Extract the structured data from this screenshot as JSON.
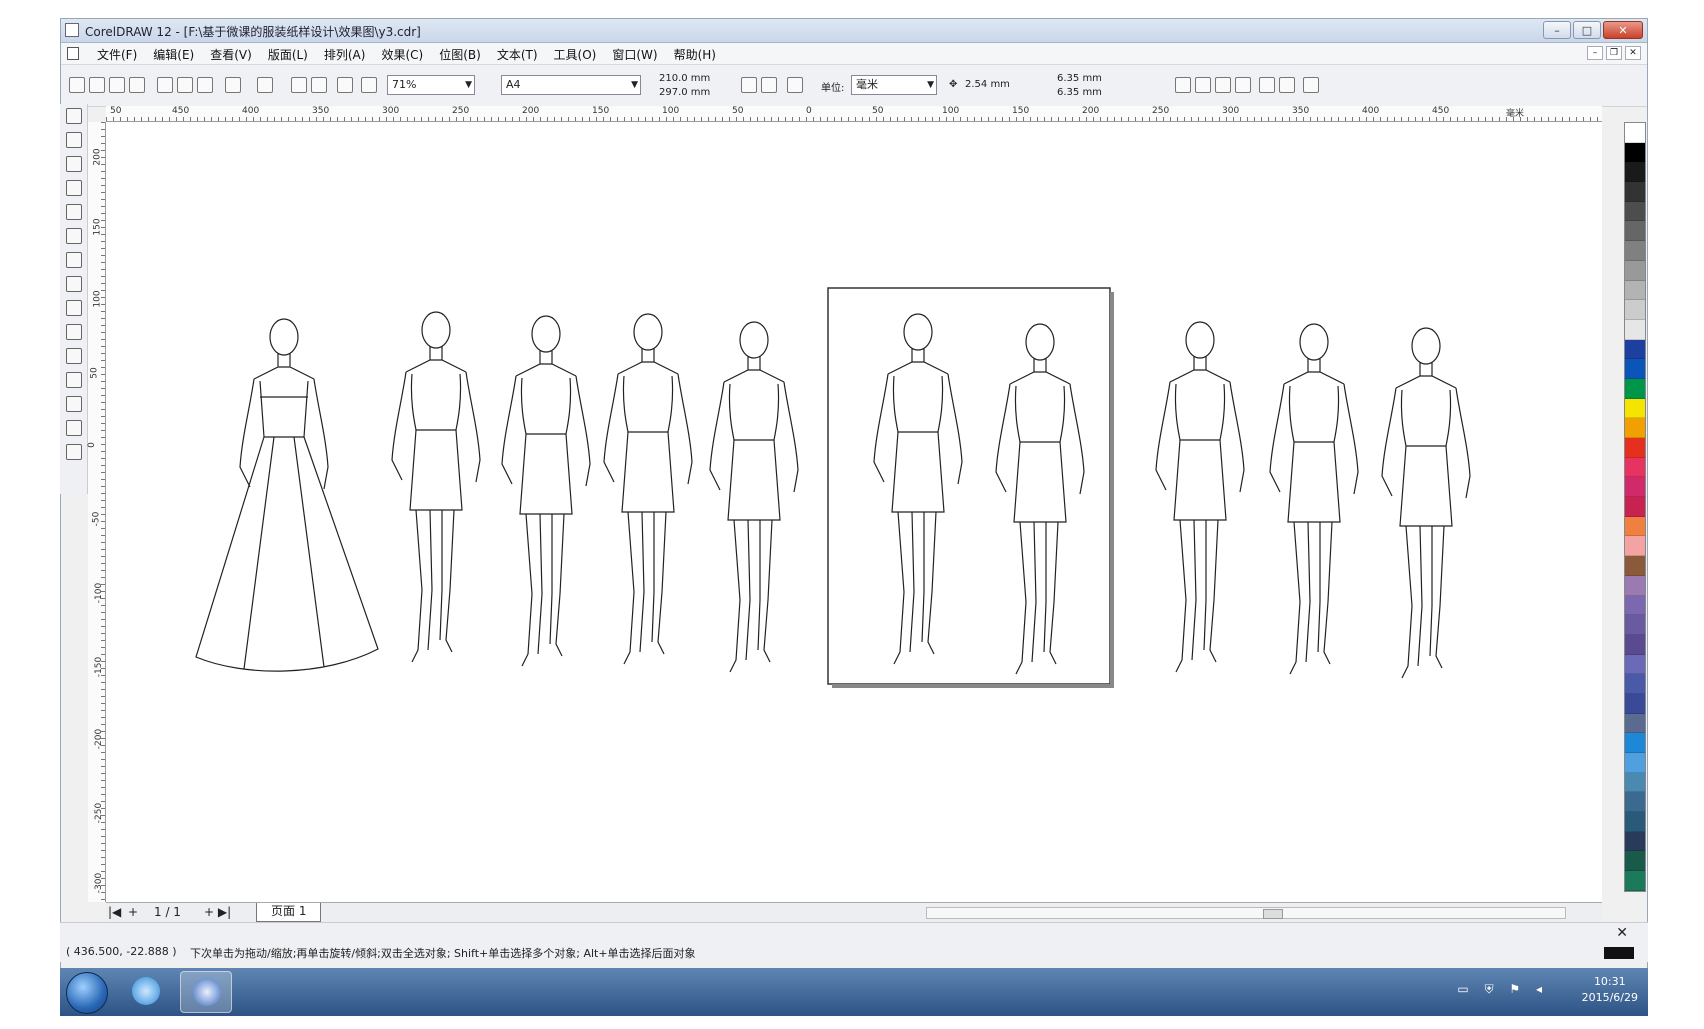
{
  "window": {
    "title": "CorelDRAW 12 - [F:\\基于微课的服装纸样设计\\效果图\\y3.cdr]",
    "min_label": "–",
    "max_label": "□",
    "close_label": "✕"
  },
  "menu": [
    "文件(F)",
    "编辑(E)",
    "查看(V)",
    "版面(L)",
    "排列(A)",
    "效果(C)",
    "位图(B)",
    "文本(T)",
    "工具(O)",
    "窗口(W)",
    "帮助(H)"
  ],
  "toolbar": {
    "zoom": "71%",
    "paper": "A4",
    "width": "210.0 mm",
    "height": "297.0 mm",
    "units_label": "单位:",
    "units": "毫米",
    "nudge": "2.54 mm",
    "dup_x": "6.35 mm",
    "dup_y": "6.35 mm"
  },
  "ruler_h": [
    "50",
    "450",
    "400",
    "350",
    "300",
    "250",
    "200",
    "150",
    "100",
    "50",
    "0",
    "50",
    "100",
    "150",
    "200",
    "250",
    "300",
    "350",
    "400",
    "450",
    "毫米"
  ],
  "ruler_v": [
    "200",
    "150",
    "100",
    "50",
    "0",
    "-50",
    "-100",
    "-150",
    "-200",
    "-250",
    "-300"
  ],
  "pages": {
    "counter": "1 / 1",
    "tab": "页面 1"
  },
  "status": {
    "coords": "( 436.500, -22.888 )",
    "hint": "下次单击为拖动/缩放;再单击旋转/倾斜;双击全选对象; Shift+单击选择多个对象; Alt+单击选择后面对象"
  },
  "clock": {
    "time": "10:31",
    "date": "2015/6/29"
  },
  "palette": [
    "#ffffff",
    "#000000",
    "#1a1a1a",
    "#333333",
    "#4d4d4d",
    "#666666",
    "#808080",
    "#999999",
    "#b3b3b3",
    "#cccccc",
    "#e6e6e6",
    "#1d3fa0",
    "#0a55b8",
    "#00964a",
    "#f5e400",
    "#f0a000",
    "#e53020",
    "#e63360",
    "#d02a6a",
    "#c82250",
    "#f08040",
    "#f4a3a3",
    "#8a5a3a",
    "#9a7ab0",
    "#7b68b0",
    "#6a5aa0",
    "#5a4a90",
    "#6a6ab8",
    "#4a5aa8",
    "#3a4a98",
    "#5a6a90",
    "#1e88d8",
    "#50a0e0",
    "#4a8ab0",
    "#3a6a90",
    "#2a5a7a",
    "#2a3a5a",
    "#1a5a4a",
    "#1a7a5a"
  ]
}
